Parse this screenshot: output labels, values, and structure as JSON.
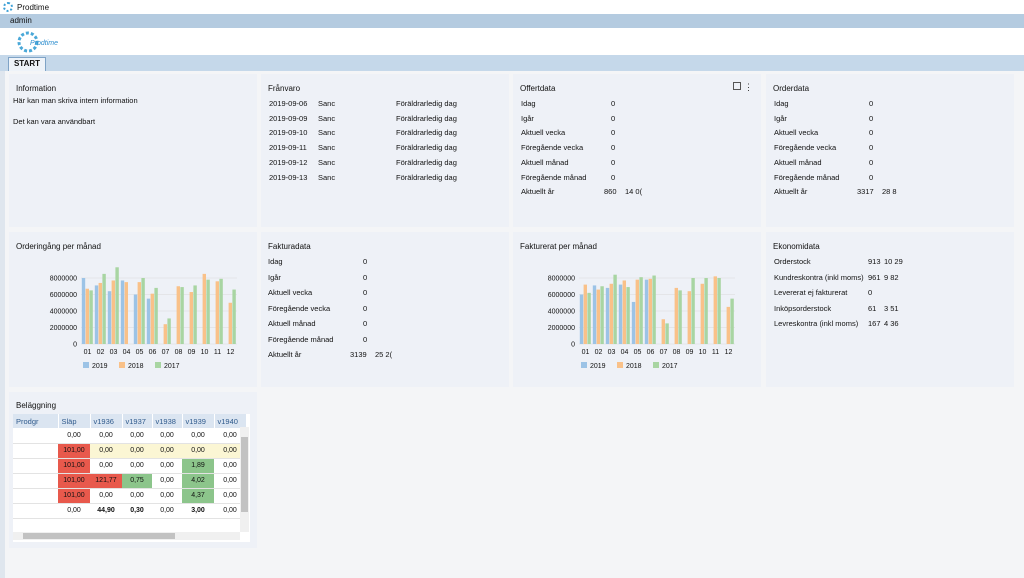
{
  "app": {
    "title": "Prodtime",
    "user": "admin",
    "logo_text": "Prodtime",
    "tab": "START"
  },
  "colors": {
    "y2019": "#9cc3e6",
    "y2018": "#f9c189",
    "y2017": "#a8d5a2",
    "red": "#e8594c",
    "green": "#8cc58b",
    "yellow": "#fbf6d4"
  },
  "information": {
    "title": "Information",
    "line1": "Här kan man skriva intern information",
    "line2": "Det kan vara användbart"
  },
  "franvaro": {
    "title": "Frånvaro",
    "rows": [
      {
        "date": "2019-09-06",
        "name": "Sanc",
        "type": "Föräldrarledig dag"
      },
      {
        "date": "2019-09-09",
        "name": "Sanc",
        "type": "Föräldrarledig dag"
      },
      {
        "date": "2019-09-10",
        "name": "Sanc",
        "type": "Föräldrarledig dag"
      },
      {
        "date": "2019-09-11",
        "name": "Sanc",
        "type": "Föräldrarledig dag"
      },
      {
        "date": "2019-09-12",
        "name": "Sanc",
        "type": "Föräldrarledig dag"
      },
      {
        "date": "2019-09-13",
        "name": "Sanc",
        "type": "Föräldrarledig dag"
      }
    ]
  },
  "offertdata": {
    "title": "Offertdata",
    "rows": [
      {
        "label": "Idag",
        "v1": "0",
        "v2": ""
      },
      {
        "label": "Igår",
        "v1": "0",
        "v2": ""
      },
      {
        "label": "Aktuell vecka",
        "v1": "0",
        "v2": ""
      },
      {
        "label": "Föregående vecka",
        "v1": "0",
        "v2": ""
      },
      {
        "label": "Aktuell månad",
        "v1": "0",
        "v2": ""
      },
      {
        "label": "Föregående månad",
        "v1": "0",
        "v2": ""
      },
      {
        "label": "Aktuellt år",
        "v1": "860",
        "v2": "14 0("
      }
    ]
  },
  "orderdata": {
    "title": "Orderdata",
    "rows": [
      {
        "label": "Idag",
        "v1": "0",
        "v2": ""
      },
      {
        "label": "Igår",
        "v1": "0",
        "v2": ""
      },
      {
        "label": "Aktuell vecka",
        "v1": "0",
        "v2": ""
      },
      {
        "label": "Föregående vecka",
        "v1": "0",
        "v2": ""
      },
      {
        "label": "Aktuell månad",
        "v1": "0",
        "v2": ""
      },
      {
        "label": "Föregående månad",
        "v1": "0",
        "v2": ""
      },
      {
        "label": "Aktuellt år",
        "v1": "3317",
        "v2": "28 8"
      }
    ]
  },
  "fakturadata": {
    "title": "Fakturadata",
    "rows": [
      {
        "label": "Idag",
        "v1": "0",
        "v2": ""
      },
      {
        "label": "Igår",
        "v1": "0",
        "v2": ""
      },
      {
        "label": "Aktuell vecka",
        "v1": "0",
        "v2": ""
      },
      {
        "label": "Föregående vecka",
        "v1": "0",
        "v2": ""
      },
      {
        "label": "Aktuell månad",
        "v1": "0",
        "v2": ""
      },
      {
        "label": "Föregående månad",
        "v1": "0",
        "v2": ""
      },
      {
        "label": "Aktuellt år",
        "v1": "3139",
        "v2": "25 2("
      }
    ]
  },
  "ekonomidata": {
    "title": "Ekonomidata",
    "rows": [
      {
        "label": "Orderstock",
        "v1": "913",
        "v2": "10 29"
      },
      {
        "label": "Kundreskontra (inkl moms)",
        "v1": "961",
        "v2": "9 82"
      },
      {
        "label": "Levererat ej fakturerat",
        "v1": "0",
        "v2": ""
      },
      {
        "label": "Inköpsorderstock",
        "v1": "61",
        "v2": "3 51"
      },
      {
        "label": "Levreskontra (inkl moms)",
        "v1": "167",
        "v2": "4 36"
      }
    ]
  },
  "chart_data": [
    {
      "type": "bar",
      "title": "Orderingång per månad",
      "categories": [
        "01",
        "02",
        "03",
        "04",
        "05",
        "06",
        "07",
        "08",
        "09",
        "10",
        "11",
        "12"
      ],
      "ylim": [
        0,
        8000000
      ],
      "yticks": [
        "0",
        "2000000",
        "4000000",
        "6000000",
        "8000000"
      ],
      "grid": true,
      "legend": "bottom",
      "series": [
        {
          "name": "2019",
          "values": [
            8000000,
            7100000,
            6400000,
            7700000,
            6000000,
            5500000,
            0,
            0,
            0,
            0,
            0,
            0
          ]
        },
        {
          "name": "2018",
          "values": [
            6700000,
            7400000,
            7700000,
            7500000,
            7500000,
            6100000,
            2400000,
            7000000,
            6300000,
            8500000,
            7600000,
            5000000
          ]
        },
        {
          "name": "2017",
          "values": [
            6500000,
            8500000,
            9300000,
            0,
            8000000,
            6800000,
            3100000,
            6900000,
            7100000,
            7800000,
            7900000,
            6600000
          ]
        }
      ]
    },
    {
      "type": "bar",
      "title": "Fakturerat per månad",
      "categories": [
        "01",
        "02",
        "03",
        "04",
        "05",
        "06",
        "07",
        "08",
        "09",
        "10",
        "11",
        "12"
      ],
      "ylim": [
        0,
        8000000
      ],
      "yticks": [
        "0",
        "2000000",
        "4000000",
        "6000000",
        "8000000"
      ],
      "grid": true,
      "legend": "bottom",
      "series": [
        {
          "name": "2019",
          "values": [
            6000000,
            7100000,
            6800000,
            7200000,
            5100000,
            7800000,
            0,
            0,
            0,
            0,
            0,
            0
          ]
        },
        {
          "name": "2018",
          "values": [
            7200000,
            6600000,
            7300000,
            7700000,
            7800000,
            7900000,
            3000000,
            6800000,
            6400000,
            7300000,
            8200000,
            4500000
          ]
        },
        {
          "name": "2017",
          "values": [
            6200000,
            7000000,
            8400000,
            6900000,
            8100000,
            8300000,
            2500000,
            6500000,
            8000000,
            8000000,
            8000000,
            5500000
          ]
        }
      ]
    }
  ],
  "belaggning": {
    "title": "Beläggning",
    "columns": [
      "Prodgr",
      "Släp",
      "v1936",
      "v1937",
      "v1938",
      "v1939",
      "v1940"
    ],
    "rows": [
      {
        "cells": [
          "",
          "0,00",
          "0,00",
          "0,00",
          "0,00",
          "0,00",
          "0,00"
        ],
        "cls": [
          "",
          "",
          "",
          "",
          "",
          "",
          ""
        ]
      },
      {
        "cells": [
          "",
          "101,00",
          "0,00",
          "0,00",
          "0,00",
          "0,00",
          "0,00"
        ],
        "cls": [
          "",
          "red",
          "yel",
          "yel",
          "yel",
          "yel",
          "yel"
        ]
      },
      {
        "cells": [
          "",
          "101,00",
          "0,00",
          "0,00",
          "0,00",
          "1,89",
          "0,00"
        ],
        "cls": [
          "",
          "red",
          "",
          "",
          "",
          "grn",
          ""
        ]
      },
      {
        "cells": [
          "",
          "101,00",
          "121,77",
          "0,75",
          "0,00",
          "4,02",
          "0,00"
        ],
        "cls": [
          "",
          "red",
          "red",
          "grn",
          "",
          "grn",
          ""
        ]
      },
      {
        "cells": [
          "",
          "101,00",
          "0,00",
          "0,00",
          "0,00",
          "4,37",
          "0,00"
        ],
        "cls": [
          "",
          "red",
          "",
          "",
          "",
          "grn",
          ""
        ]
      },
      {
        "cells": [
          "",
          "0,00",
          "44,90",
          "0,30",
          "0,00",
          "3,00",
          "0,00"
        ],
        "cls": [
          "",
          "",
          "b",
          "b",
          "",
          "b",
          ""
        ]
      }
    ]
  }
}
